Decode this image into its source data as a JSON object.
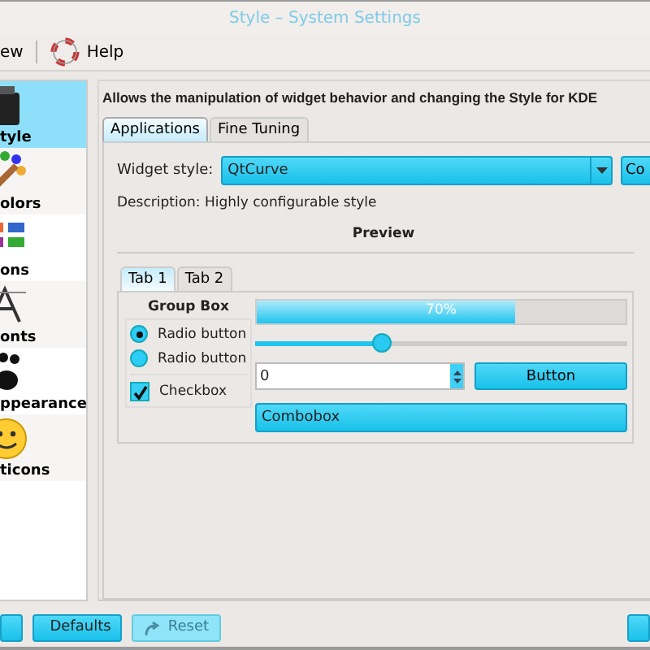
{
  "window": {
    "title": "Style – System Settings"
  },
  "toolbar": [
    {
      "label": "ew",
      "kind": "text"
    },
    {
      "label": "Help",
      "kind": "help"
    }
  ],
  "sidebar": {
    "items": [
      {
        "label": "tyle",
        "kind": "style",
        "selected": true
      },
      {
        "label": "olors",
        "kind": "colors",
        "selected": false
      },
      {
        "label": "ons",
        "kind": "grid",
        "selected": false
      },
      {
        "label": "onts",
        "kind": "font",
        "selected": false
      },
      {
        "label": "ppearance",
        "kind": "paw",
        "selected": false
      },
      {
        "label": "ticons",
        "kind": "smiley",
        "selected": false
      }
    ]
  },
  "header": "Allows the manipulation of widget behavior and changing the Style for KDE",
  "tabs": [
    {
      "label": "Applications",
      "selected": true
    },
    {
      "label": "Fine Tuning",
      "selected": false
    }
  ],
  "widget_style": {
    "label": "Widget style:",
    "value": "QtCurve",
    "button": "Co"
  },
  "description": "Description: Highly configurable style",
  "preview": {
    "title": "Preview",
    "tabs": [
      {
        "label": "Tab 1",
        "selected": true
      },
      {
        "label": "Tab 2",
        "selected": false
      }
    ],
    "group_box": {
      "title": "Group Box",
      "radios": [
        {
          "label": "Radio button",
          "selected": true
        },
        {
          "label": "Radio button",
          "selected": false
        }
      ],
      "checkbox": {
        "label": "Checkbox",
        "checked": true
      }
    },
    "progress": {
      "level": 0.7,
      "text": "70%"
    },
    "slider": {
      "level": 0.34
    },
    "spin": {
      "value": "0"
    },
    "button": "Button",
    "combo": "Combobox"
  },
  "bottom_bar": {
    "left": [
      {
        "kind": "blank",
        "disabled": false
      },
      {
        "label": "Defaults",
        "kind": "defaults",
        "disabled": false
      },
      {
        "label": "Reset",
        "kind": "reset",
        "disabled": true
      }
    ],
    "right": [
      {
        "kind": "blank",
        "disabled": false
      }
    ]
  }
}
